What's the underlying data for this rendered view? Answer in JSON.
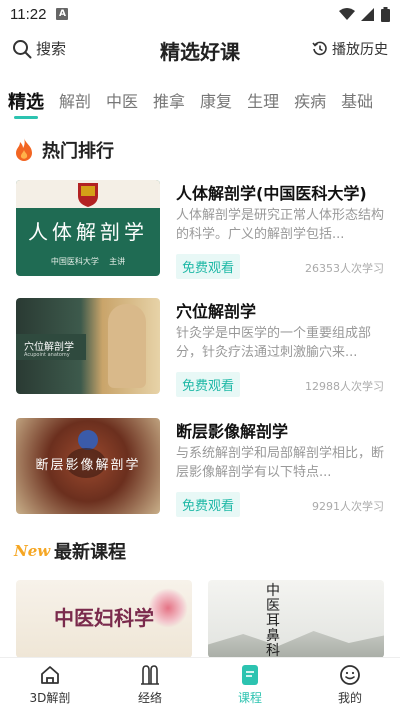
{
  "status_bar": {
    "time": "11:22",
    "app_badge": "A"
  },
  "header": {
    "search_label": "搜索",
    "title": "精选好课",
    "history_label": "播放历史"
  },
  "tabs": [
    "精选",
    "解剖",
    "中医",
    "推拿",
    "康复",
    "生理",
    "疾病",
    "基础"
  ],
  "hot": {
    "title": "热门排行",
    "courses": [
      {
        "title": "人体解剖学(中国医科大学)",
        "desc": "人体解剖学是研究正常人体形态结构的科学。广义的解剖学包括...",
        "free_label": "免费观看",
        "count": "26353人次学习",
        "thumb_title": "人体解剖学",
        "thumb_caption": "中国医科大学    主讲"
      },
      {
        "title": "穴位解剖学",
        "desc": "针灸学是中医学的一个重要组成部分，针灸疗法通过刺激腧穴来...",
        "free_label": "免费观看",
        "count": "12988人次学习",
        "thumb_title": "穴位解剖学",
        "thumb_caption": "Acupoint anatomy"
      },
      {
        "title": "断层影像解剖学",
        "desc": "与系统解剖学和局部解剖学相比，断层影像解剖学有以下特点...",
        "free_label": "免费观看",
        "count": "9291人次学习",
        "thumb_title": "断层影像解剖学"
      }
    ]
  },
  "latest": {
    "badge": "New",
    "title": "最新课程",
    "thumbs": [
      {
        "title": "中医妇科学"
      },
      {
        "title": "中医耳鼻科学"
      }
    ]
  },
  "bottom_nav": [
    {
      "label": "3D解剖"
    },
    {
      "label": "经络"
    },
    {
      "label": "课程"
    },
    {
      "label": "我的"
    }
  ],
  "colors": {
    "accent": "#2cc3b0",
    "fire": "#f26522",
    "new_badge": "#f5a623"
  }
}
